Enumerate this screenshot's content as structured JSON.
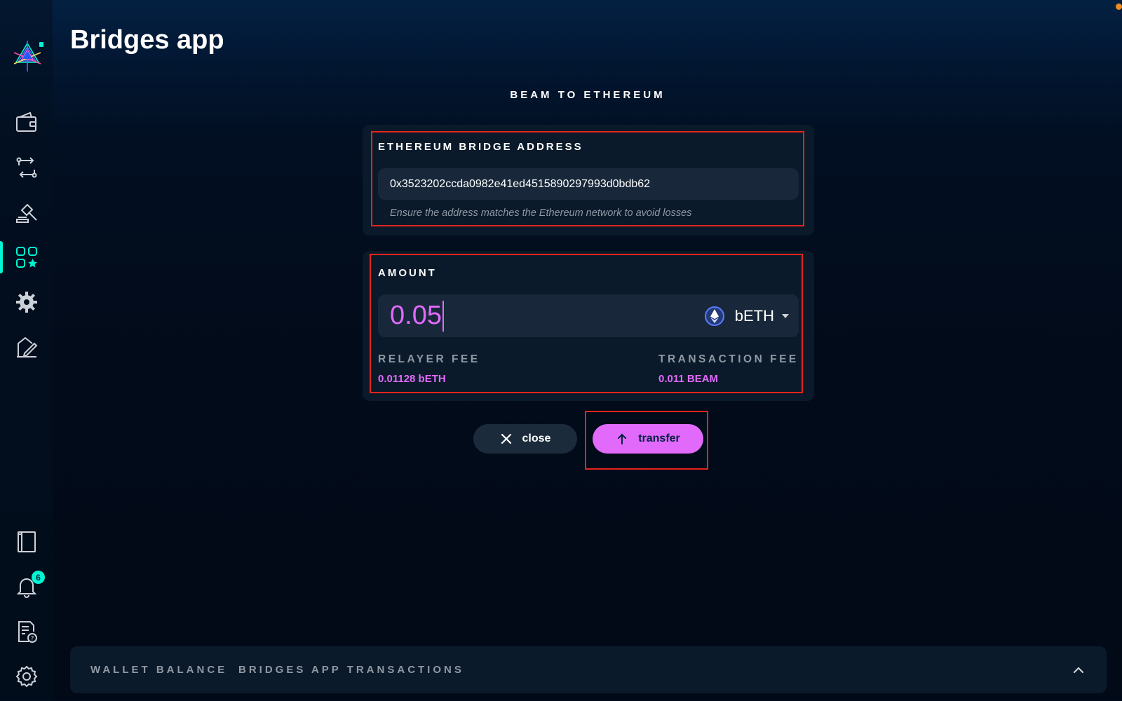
{
  "app": {
    "title": "Bridges app"
  },
  "sidebar": {
    "items": [
      {
        "icon": "wallet-icon"
      },
      {
        "icon": "swap-icon"
      },
      {
        "icon": "auction-icon"
      },
      {
        "icon": "dapps-icon",
        "active": true
      },
      {
        "icon": "gear-icon"
      },
      {
        "icon": "sign-icon"
      },
      {
        "icon": "address-book-icon"
      },
      {
        "icon": "bell-icon",
        "badge": "6"
      },
      {
        "icon": "help-document-icon"
      },
      {
        "icon": "settings-icon"
      }
    ],
    "accent_color": "#00f6d2"
  },
  "form": {
    "section_title": "BEAM TO ETHEREUM",
    "address": {
      "label": "ETHEREUM BRIDGE ADDRESS",
      "value": "0x3523202ccda0982e41ed4515890297993d0bdb62",
      "hint": "Ensure the address matches the Ethereum network to avoid losses"
    },
    "amount": {
      "label": "AMOUNT",
      "value": "0.05",
      "currency": "bETH",
      "currency_icon": "ethereum-icon"
    },
    "fees": {
      "relayer_label": "RELAYER FEE",
      "relayer_value": "0.01128 bETH",
      "transaction_label": "TRANSACTION FEE",
      "transaction_value": "0.011 BEAM"
    }
  },
  "actions": {
    "close_label": "close",
    "transfer_label": "transfer"
  },
  "bottom_bar": {
    "tabs": [
      "WALLET BALANCE",
      "BRIDGES APP TRANSACTIONS"
    ]
  },
  "colors": {
    "primary_accent": "#e16afb",
    "teal_accent": "#00f6d2",
    "highlight_border": "#e3241b",
    "card_background": "#0b1a2a"
  }
}
